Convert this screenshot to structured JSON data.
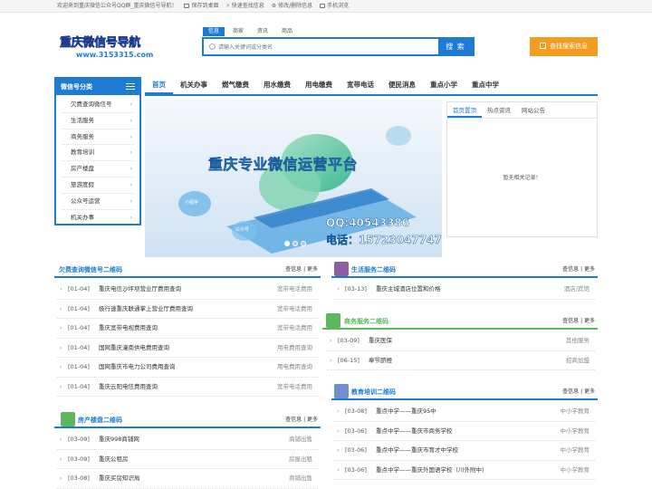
{
  "topbar": {
    "welcome": "欢迎来到重庆微信公众号QQ群_重庆微信号导航！",
    "links": [
      "保存到桌面",
      "快速查找信息",
      "修改/删除信息",
      "手机浏览"
    ]
  },
  "logo": {
    "title": "重庆微信号导航",
    "url": "www.3153315.com"
  },
  "search": {
    "tabs": [
      "信息",
      "商家",
      "资讯",
      "商品"
    ],
    "active_tab": "信息",
    "placeholder": "请输入关键词或分类名",
    "button": "搜 索"
  },
  "find_button": "查找搜索信息",
  "sidebar": {
    "title": "微信号分类",
    "items": [
      "欠费查询微信号",
      "生活服务",
      "商务服务",
      "教育培训",
      "房产楼盘",
      "旅游度假",
      "公众号运营",
      "机关办事"
    ]
  },
  "nav": {
    "items": [
      "首页",
      "机关办事",
      "燃气缴费",
      "用水缴费",
      "用电缴费",
      "宽带电话",
      "便民消息",
      "重点小学",
      "重点中学"
    ],
    "active": "首页"
  },
  "banner": {
    "title": "重庆专业微信运营平台",
    "qq": "QQ:40543386",
    "tel": "电话：15723047747",
    "badge1": "小程序",
    "badge2": "公众号"
  },
  "news": {
    "tabs": [
      "首页置顶",
      "热点资讯",
      "网站公告"
    ],
    "active": "首页置顶",
    "empty": "暂无相关记录！"
  },
  "panels": {
    "arrears": {
      "title": "欠费查询微信号二维码",
      "more": "查信息 | 更多",
      "rows": [
        {
          "date": "[01-04]",
          "name": "重庆电信沙坪坝营业厅费用查询",
          "cat": "宽带电话费用"
        },
        {
          "date": "[01-04]",
          "name": "极行速重庆联通掌上营业厅费用查询",
          "cat": "宽带电话费用"
        },
        {
          "date": "[01-04]",
          "name": "重庆宽带电视费用查询",
          "cat": "宽带电话费用"
        },
        {
          "date": "[01-04]",
          "name": "国网重庆潼南供电费用查询",
          "cat": "用电费用查询"
        },
        {
          "date": "[01-04]",
          "name": "国网重庆市电力公司费用查询",
          "cat": "用电费用查询"
        },
        {
          "date": "[01-04]",
          "name": "重庆云阳电信费用查询",
          "cat": "宽带电话费用"
        }
      ]
    },
    "life": {
      "title": "生活服务二维码",
      "more": "查信息 | 更多",
      "rows": [
        {
          "date": "[03-13]",
          "name": "重庆主城酒店位置和价格",
          "cat": "酒店/宾馆"
        }
      ]
    },
    "business": {
      "title": "商务服务二维码",
      "more": "查信息 | 更多",
      "rows": [
        {
          "date": "[03-09]",
          "name": "重庆医保",
          "cat": "其他服务"
        },
        {
          "date": "[06-15]",
          "name": "奉节脐橙",
          "cat": "招商加盟"
        }
      ]
    },
    "education": {
      "title": "教育培训二维码",
      "more": "查信息 | 更多",
      "rows": [
        {
          "date": "[03-08]",
          "name": "重点中学——重庆95中",
          "cat": "中小学教育"
        },
        {
          "date": "[03-06]",
          "name": "重点中学——重庆市商务学校",
          "cat": "中小学教育"
        },
        {
          "date": "[03-06]",
          "name": "重点中学——重庆市育才中学校",
          "cat": "中小学教育"
        },
        {
          "date": "[03-06]",
          "name": "重点中学——重庆外国语学校（川外附中）",
          "cat": "中小学教育"
        }
      ]
    },
    "realestate": {
      "title": "房产楼盘二维码",
      "more": "查信息 | 更多",
      "rows": [
        {
          "date": "[03-09]",
          "name": "重庆998商铺网",
          "cat": "商铺出售"
        },
        {
          "date": "[03-09]",
          "name": "重庆公租房",
          "cat": "房屋出租"
        },
        {
          "date": "[03-08]",
          "name": "重庆买房知识局",
          "cat": "商铺出售"
        }
      ]
    }
  },
  "colors": {
    "primary": "#1e7bd4",
    "orange": "#f39c1f",
    "green": "#5cb85c",
    "purple": "#8e5ea2"
  }
}
